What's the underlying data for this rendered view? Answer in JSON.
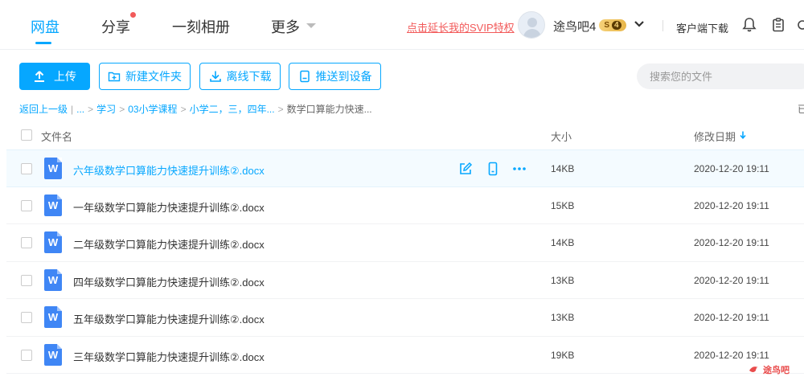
{
  "nav": {
    "tabs": [
      {
        "label": "网盘",
        "active": true
      },
      {
        "label": "分享",
        "active": false
      },
      {
        "label": "一刻相册",
        "active": false
      },
      {
        "label": "更多",
        "active": false
      }
    ],
    "promo_text": "点击延长我的SVIP特权",
    "username": "途鸟吧4",
    "vip_level": "S",
    "vip_num": "4",
    "client_download": "客户端下载",
    "icons": [
      "bell-icon",
      "clipboard-icon"
    ]
  },
  "toolbar": {
    "upload": "上传",
    "new_folder": "新建文件夹",
    "offline_download": "离线下载",
    "push_to_device": "推送到设备",
    "search_placeholder": "搜索您的文件"
  },
  "breadcrumb": {
    "back": "返回上一级",
    "ellipsis": "...",
    "items": [
      "学习",
      "03小学课程",
      "小学二，三，四年..."
    ],
    "current": "数学口算能力快速...",
    "loaded_hint": "已"
  },
  "table": {
    "headers": {
      "name": "文件名",
      "size": "大小",
      "date": "修改日期"
    },
    "sort": "desc",
    "rows": [
      {
        "icon": "W",
        "name": "六年级数学口算能力快速提升训练②.docx",
        "size": "14KB",
        "date": "2020-12-20 19:11",
        "hover": true
      },
      {
        "icon": "W",
        "name": "一年级数学口算能力快速提升训练②.docx",
        "size": "15KB",
        "date": "2020-12-20 19:11"
      },
      {
        "icon": "W",
        "name": "二年级数学口算能力快速提升训练②.docx",
        "size": "14KB",
        "date": "2020-12-20 19:11"
      },
      {
        "icon": "W",
        "name": "四年级数学口算能力快速提升训练②.docx",
        "size": "13KB",
        "date": "2020-12-20 19:11"
      },
      {
        "icon": "W",
        "name": "五年级数学口算能力快速提升训练②.docx",
        "size": "13KB",
        "date": "2020-12-20 19:11"
      },
      {
        "icon": "W",
        "name": "三年级数学口算能力快速提升训练②.docx",
        "size": "19KB",
        "date": "2020-12-20 19:11"
      }
    ]
  },
  "watermark": "途鸟吧",
  "colors": {
    "accent": "#06a7ff",
    "promo": "#f25a5a",
    "doc_icon": "#3f86f5"
  }
}
